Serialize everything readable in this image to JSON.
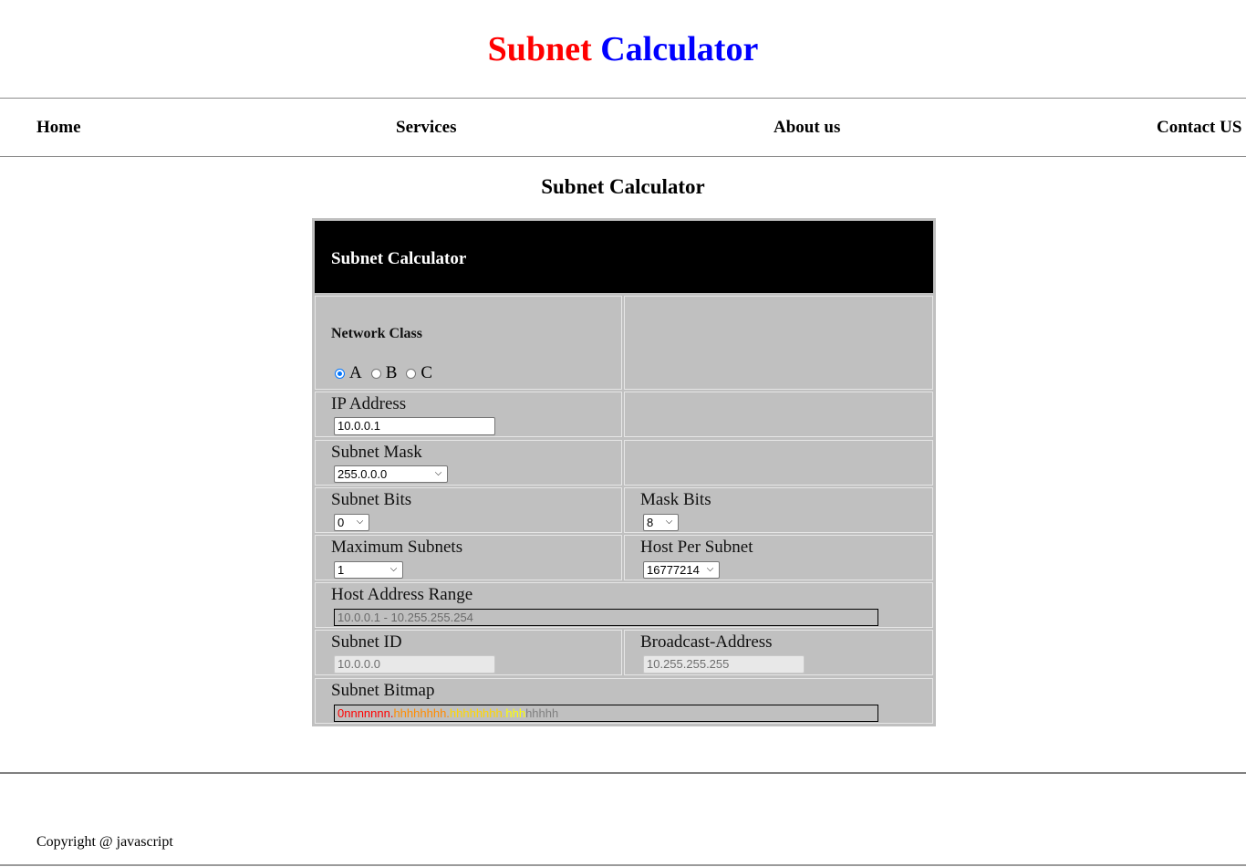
{
  "header": {
    "title_word1": "Subnet",
    "title_word2": "Calculator",
    "title_word1_color": "#ff0000",
    "title_word2_color": "#0000ff"
  },
  "nav": {
    "home": "Home",
    "services": "Services",
    "about": "About us",
    "contact": "Contact US"
  },
  "page_heading": "Subnet Calculator",
  "calculator": {
    "panel_title": "Subnet Calculator",
    "network_class": {
      "label": "Network Class",
      "options": [
        "A",
        "B",
        "C"
      ],
      "selected": "A"
    },
    "ip_address": {
      "label": "IP Address",
      "value": "10.0.0.1"
    },
    "subnet_mask": {
      "label": "Subnet Mask",
      "value": "255.0.0.0"
    },
    "subnet_bits": {
      "label": "Subnet Bits",
      "value": "0"
    },
    "mask_bits": {
      "label": "Mask Bits",
      "value": "8"
    },
    "maximum_subnets": {
      "label": "Maximum Subnets",
      "value": "1"
    },
    "host_per_subnet": {
      "label": "Host Per Subnet",
      "value": "16777214"
    },
    "host_address_range": {
      "label": "Host Address Range",
      "value": "10.0.0.1 - 10.255.255.254"
    },
    "subnet_id": {
      "label": "Subnet ID",
      "value": "10.0.0.0"
    },
    "broadcast_address": {
      "label": "Broadcast-Address",
      "value": "10.255.255.255"
    },
    "subnet_bitmap": {
      "label": "Subnet Bitmap",
      "segments": [
        {
          "text": "0nnnnnnn.",
          "color": "#ff0000"
        },
        {
          "text": "hhhhhhhh.",
          "color": "#ff8c00"
        },
        {
          "text": "hhhhhhhh.",
          "color": "#ffd700"
        },
        {
          "text": "hhh",
          "color": "#ffff00"
        },
        {
          "text": "hhhhh",
          "color": "#808080"
        }
      ]
    }
  },
  "footer": {
    "copyright": "Copyright @ javascript"
  }
}
